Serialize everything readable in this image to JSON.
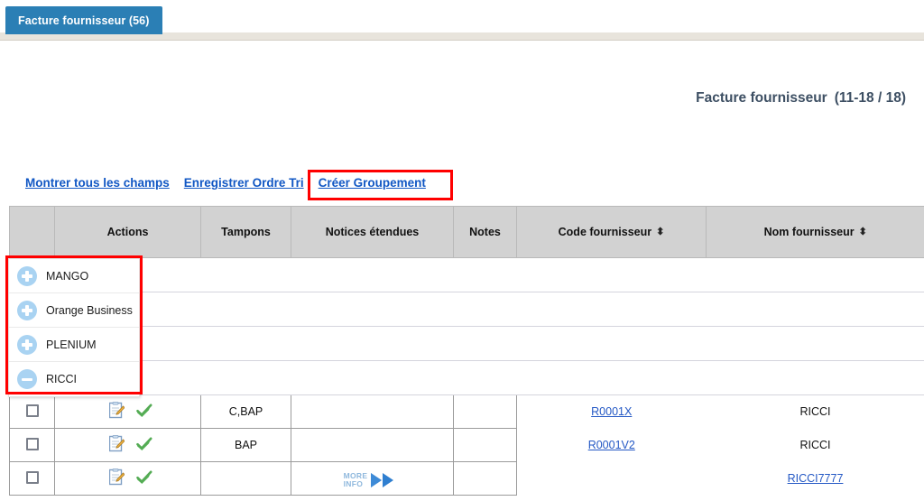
{
  "tab": {
    "label": "Facture fournisseur (56)"
  },
  "page": {
    "title": "Facture fournisseur",
    "count": "(11-18 / 18)"
  },
  "links": [
    {
      "label": "Montrer tous les champs",
      "name": "show-all-fields-link"
    },
    {
      "label": "Enregistrer Ordre Tri",
      "name": "save-sort-order-link"
    },
    {
      "label": "Créer Groupement",
      "name": "create-grouping-link"
    }
  ],
  "table": {
    "headers": [
      {
        "label": "",
        "sortable": false
      },
      {
        "label": "Actions",
        "sortable": false
      },
      {
        "label": "Tampons",
        "sortable": false
      },
      {
        "label": "Notices étendues",
        "sortable": false
      },
      {
        "label": "Notes",
        "sortable": false
      },
      {
        "label": "Code fournisseur",
        "sortable": true,
        "sort_icon": "⬍"
      },
      {
        "label": "Nom fournisseur",
        "sortable": true,
        "sort_icon": "⬍"
      }
    ],
    "group_rows": [
      {
        "label": "MANGO"
      },
      {
        "label": "Orange Business"
      },
      {
        "label": "PLENIUM"
      },
      {
        "label": "RICCI"
      }
    ],
    "rows": [
      {
        "checkbox": false,
        "actions": [
          "edit-icon",
          "validate-check-icon"
        ],
        "tampons": "C,BAP",
        "notices_etendues": "",
        "notes": "",
        "code_fournisseur": "R0001X",
        "code_is_link": true,
        "nom_fournisseur": "RICCI",
        "nom_is_link": false
      },
      {
        "checkbox": false,
        "actions": [
          "edit-icon",
          "validate-check-icon"
        ],
        "tampons": "BAP",
        "notices_etendues": "",
        "notes": "",
        "code_fournisseur": "R0001V2",
        "code_is_link": true,
        "nom_fournisseur": "RICCI",
        "nom_is_link": false
      },
      {
        "checkbox": false,
        "actions": [
          "edit-icon",
          "validate-check-icon"
        ],
        "tampons": "",
        "notices_etendues": "more-info-icon",
        "more_info_line1": "MORE",
        "more_info_line2": "INFO",
        "notes": "",
        "code_fournisseur": "",
        "code_is_link": false,
        "nom_fournisseur": "RICCI7777",
        "nom_is_link": true
      }
    ]
  },
  "popup": {
    "items": [
      {
        "label": "MANGO",
        "state": "collapsed",
        "icon": "plus-circle-icon"
      },
      {
        "label": "Orange Business",
        "state": "collapsed",
        "icon": "plus-circle-icon"
      },
      {
        "label": "PLENIUM",
        "state": "collapsed",
        "icon": "plus-circle-icon"
      },
      {
        "label": "RICCI",
        "state": "expanded",
        "icon": "minus-circle-icon"
      }
    ]
  },
  "colors": {
    "tab_blue": "#2b7fb5",
    "link_blue": "#1157c4",
    "title_slate": "#3d4f63",
    "header_gray": "#d2d2d2",
    "highlight_red": "#ff0000",
    "circle_blue": "#a9d3f2",
    "check_green": "#5cb85c"
  }
}
